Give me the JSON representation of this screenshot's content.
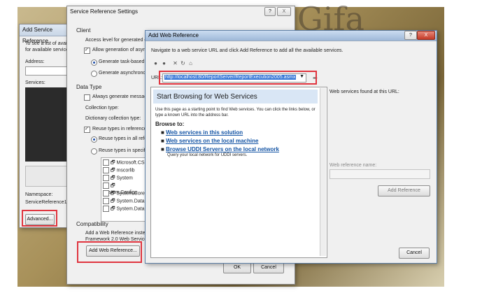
{
  "background": {
    "text": "Gifa"
  },
  "add_service": {
    "title": "Add Service Reference",
    "desc1": "To see a list of availa",
    "desc2": "for available service",
    "address_label": "Address:",
    "services_label": "Services:",
    "namespace_label": "Namespace:",
    "namespace_value": "ServiceReference1",
    "advanced_button": "Advanced..."
  },
  "settings": {
    "title": "Service Reference Settings",
    "help_button": "?",
    "close_button": "X",
    "client_label": "Client",
    "access_level": "Access level for generated cla",
    "allow_async": "Allow generation of asynch",
    "task_based": "Generate task-based op",
    "async_ops": "Generate asynchronous",
    "data_type_label": "Data Type",
    "always_generate": "Always generate message",
    "collection_type": "Collection type:",
    "dictionary_type": "Dictionary collection type:",
    "reuse_types": "Reuse types in referenced a",
    "reuse_all": "Reuse types in all refere",
    "reuse_specified": "Reuse types in specifie",
    "assemblies": [
      "Microsoft.CSha",
      "mscorlib",
      "System",
      "System.Configu",
      "System.Core",
      "System.Data",
      "System.Data.D"
    ],
    "compat_label": "Compatibility",
    "compat_text1": "Add a Web Reference instead",
    "compat_text2": "Framework 2.0 Web Services t",
    "add_web_ref_button": "Add Web Reference...",
    "ok_button": "OK",
    "cancel_button": "Cancel"
  },
  "web_ref": {
    "title": "Add Web Reference",
    "help_button": "?",
    "close_button": "X",
    "instruction": "Navigate to a web service URL and click Add Reference to add all the available services.",
    "url_label": "URL:",
    "url_value": "http://localhost:80/ReportServer/ReportExecution2005.asmx",
    "heading": "Start Browsing for Web Services",
    "intro1": "Use this page as a starting point to find Web services. You can click the links below, or",
    "intro2": "type a known URL into the address bar.",
    "browse_to": "Browse to:",
    "links": [
      {
        "text": "Web services in this solution",
        "sub": ""
      },
      {
        "text": "Web services on the local machine",
        "sub": ""
      },
      {
        "text": "Browse UDDI Servers on the local network",
        "sub": "Query your local network for UDDI servers."
      }
    ],
    "found_label": "Web services found at this URL:",
    "ref_name_label": "Web reference name:",
    "add_reference_button": "Add Reference",
    "cancel_button": "Cancel"
  }
}
